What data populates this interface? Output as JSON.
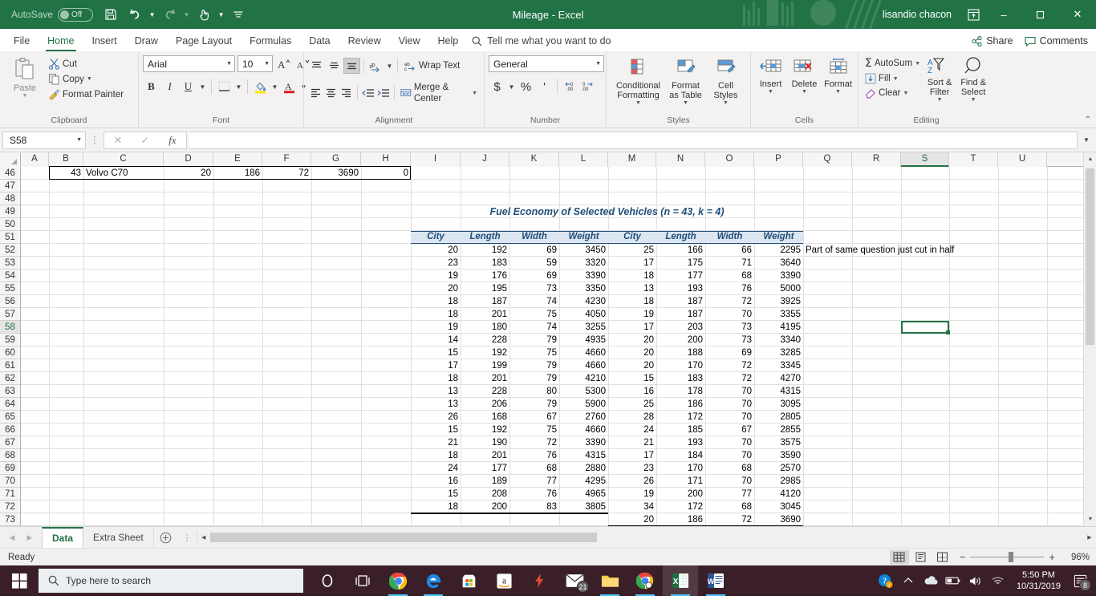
{
  "titlebar": {
    "autosave_label": "AutoSave",
    "autosave_state": "Off",
    "save_icon": "save-icon",
    "undo_icon": "undo-icon",
    "redo_icon": "redo-icon",
    "touch_icon": "touch-mode-icon",
    "customize_icon": "customize-qat-icon",
    "document_title": "Mileage  -  Excel",
    "user_name": "lisandio chacon",
    "ribbon_display_icon": "ribbon-display-options-icon",
    "minimize": "–",
    "restore": "❐",
    "close": "✕"
  },
  "ribbon": {
    "tabs": [
      {
        "label": "File",
        "active": false
      },
      {
        "label": "Home",
        "active": true
      },
      {
        "label": "Insert",
        "active": false
      },
      {
        "label": "Draw",
        "active": false
      },
      {
        "label": "Page Layout",
        "active": false
      },
      {
        "label": "Formulas",
        "active": false
      },
      {
        "label": "Data",
        "active": false
      },
      {
        "label": "Review",
        "active": false
      },
      {
        "label": "View",
        "active": false
      },
      {
        "label": "Help",
        "active": false
      }
    ],
    "tell_me": "Tell me what you want to do",
    "share_label": "Share",
    "comments_label": "Comments",
    "collapse_icon": "collapse-ribbon-icon",
    "groups": {
      "clipboard": {
        "label": "Clipboard",
        "paste": "Paste",
        "cut": "Cut",
        "copy": "Copy",
        "format_painter": "Format Painter"
      },
      "font": {
        "label": "Font",
        "font_name": "Arial",
        "font_size": "10",
        "grow_font": "A",
        "shrink_font": "A",
        "bold": "B",
        "italic": "I",
        "underline": "U"
      },
      "alignment": {
        "label": "Alignment",
        "wrap_text": "Wrap Text",
        "merge_center": "Merge & Center"
      },
      "number": {
        "label": "Number",
        "format": "General",
        "currency": "$",
        "percent": "%",
        "comma": "'"
      },
      "styles": {
        "label": "Styles",
        "conditional_formatting": "Conditional Formatting",
        "format_as_table": "Format as Table",
        "cell_styles": "Cell Styles"
      },
      "cells": {
        "label": "Cells",
        "insert": "Insert",
        "delete": "Delete",
        "format": "Format"
      },
      "editing": {
        "label": "Editing",
        "autosum": "AutoSum",
        "fill": "Fill",
        "clear": "Clear",
        "sort_filter": "Sort & Filter",
        "find_select": "Find & Select"
      }
    }
  },
  "formula_bar": {
    "name_box": "S58",
    "cancel_icon": "cancel-icon",
    "enter_icon": "confirm-icon",
    "function_icon": "insert-function-icon",
    "formula_value": "",
    "expand_icon": "expand-formula-bar-icon"
  },
  "grid": {
    "columns": [
      "A",
      "B",
      "C",
      "D",
      "E",
      "F",
      "G",
      "H",
      "I",
      "J",
      "K",
      "L",
      "M",
      "N",
      "O",
      "P",
      "Q",
      "R",
      "S",
      "T",
      "U"
    ],
    "selected_column": "S",
    "selected_row": "58",
    "active_cell": "S58",
    "rows": [
      "46",
      "47",
      "48",
      "49",
      "50",
      "51",
      "52",
      "53",
      "54",
      "55",
      "56",
      "57",
      "58",
      "59",
      "60",
      "61",
      "62",
      "63",
      "64",
      "65",
      "66",
      "67",
      "68",
      "69",
      "70",
      "71",
      "72",
      "73"
    ],
    "top_row_data": {
      "row": "46",
      "B": "43",
      "C": "Volvo C70",
      "D": "20",
      "E": "186",
      "F": "72",
      "G": "3690",
      "H": "0"
    },
    "chart_title": "Fuel Economy of Selected Vehicles (n = 43, k = 4)",
    "note": "Part of same question just cut in half",
    "headers": [
      "City",
      "Length",
      "Width",
      "Weight"
    ],
    "left_table": [
      [
        20,
        192,
        69,
        3450
      ],
      [
        23,
        183,
        59,
        3320
      ],
      [
        19,
        176,
        69,
        3390
      ],
      [
        20,
        195,
        73,
        3350
      ],
      [
        18,
        187,
        74,
        4230
      ],
      [
        18,
        201,
        75,
        4050
      ],
      [
        19,
        180,
        74,
        3255
      ],
      [
        14,
        228,
        79,
        4935
      ],
      [
        15,
        192,
        75,
        4660
      ],
      [
        17,
        199,
        79,
        4660
      ],
      [
        18,
        201,
        79,
        4210
      ],
      [
        13,
        228,
        80,
        5300
      ],
      [
        13,
        206,
        79,
        5900
      ],
      [
        26,
        168,
        67,
        2760
      ],
      [
        15,
        192,
        75,
        4660
      ],
      [
        21,
        190,
        72,
        3390
      ],
      [
        18,
        201,
        76,
        4315
      ],
      [
        24,
        177,
        68,
        2880
      ],
      [
        16,
        189,
        77,
        4295
      ],
      [
        15,
        208,
        76,
        4965
      ],
      [
        18,
        200,
        83,
        3805
      ]
    ],
    "right_table": [
      [
        25,
        166,
        66,
        2295
      ],
      [
        17,
        175,
        71,
        3640
      ],
      [
        18,
        177,
        68,
        3390
      ],
      [
        13,
        193,
        76,
        5000
      ],
      [
        18,
        187,
        72,
        3925
      ],
      [
        19,
        187,
        70,
        3355
      ],
      [
        17,
        203,
        73,
        4195
      ],
      [
        20,
        200,
        73,
        3340
      ],
      [
        20,
        188,
        69,
        3285
      ],
      [
        20,
        170,
        72,
        3345
      ],
      [
        15,
        183,
        72,
        4270
      ],
      [
        16,
        178,
        70,
        4315
      ],
      [
        25,
        186,
        70,
        3095
      ],
      [
        28,
        172,
        70,
        2805
      ],
      [
        24,
        185,
        67,
        2855
      ],
      [
        21,
        193,
        70,
        3575
      ],
      [
        17,
        184,
        70,
        3590
      ],
      [
        23,
        170,
        68,
        2570
      ],
      [
        26,
        171,
        70,
        2985
      ],
      [
        19,
        200,
        77,
        4120
      ],
      [
        34,
        172,
        68,
        3045
      ],
      [
        20,
        186,
        72,
        3690
      ]
    ]
  },
  "sheet_tabs": {
    "first_icon": "first-sheet-icon",
    "prev_icon": "previous-sheet-icon",
    "tabs": [
      {
        "label": "Data",
        "active": true
      },
      {
        "label": "Extra Sheet",
        "active": false
      }
    ],
    "add_sheet": "+"
  },
  "status_bar": {
    "state": "Ready",
    "view_normal": "normal-view-icon",
    "view_page_layout": "page-layout-view-icon",
    "view_page_break": "page-break-view-icon",
    "zoom_out": "−",
    "zoom_in": "+",
    "zoom_level": "96%"
  },
  "taskbar": {
    "start_icon": "windows-start-icon",
    "search_placeholder": "Type here to search",
    "search_icon": "search-icon",
    "cortana_icon": "cortana-icon",
    "task_view_icon": "task-view-icon",
    "apps": [
      {
        "name": "chrome-icon"
      },
      {
        "name": "edge-icon"
      },
      {
        "name": "microsoft-store-icon"
      },
      {
        "name": "amazon-icon"
      },
      {
        "name": "lightning-app-icon"
      },
      {
        "name": "mail-icon",
        "badge": "21"
      },
      {
        "name": "file-explorer-icon"
      },
      {
        "name": "chrome-running-icon"
      },
      {
        "name": "excel-icon"
      },
      {
        "name": "word-icon"
      }
    ],
    "tray": {
      "help_icon": "help-icon",
      "chevron_icon": "show-hidden-icons-icon",
      "onedrive_icon": "onedrive-icon",
      "battery_icon": "battery-icon",
      "volume_icon": "volume-icon",
      "wifi_icon": "wifi-icon",
      "time": "5:50 PM",
      "date": "10/31/2019",
      "notification_icon": "notifications-icon",
      "notification_count": "8"
    }
  },
  "colors": {
    "excel_green": "#217346",
    "header_blue": "#1f4e79",
    "header_fill": "#dce6f1"
  }
}
